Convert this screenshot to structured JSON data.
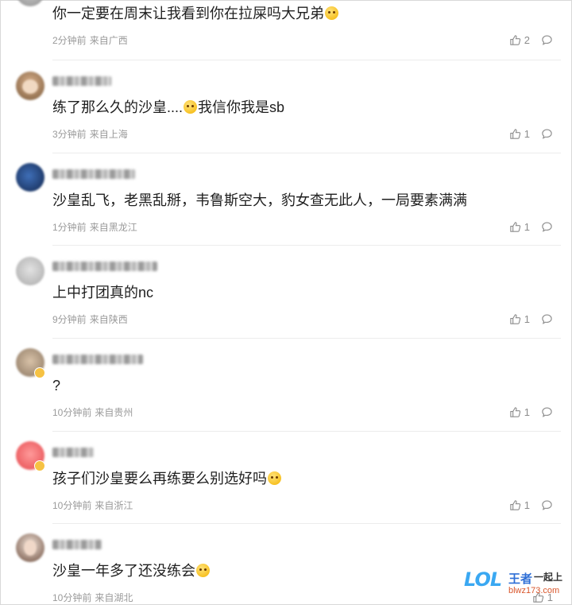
{
  "comments": [
    {
      "text": "你一定要在周末让我看到你在拉屎吗大兄弟",
      "emoji": "smile",
      "time": "2分钟前",
      "region": "来自广西",
      "likes": "2"
    },
    {
      "text_before": "练了那么久的沙皇....",
      "emoji": "wink",
      "text_after": "我信你我是sb",
      "time": "3分钟前",
      "region": "来自上海",
      "likes": "1"
    },
    {
      "text": "沙皇乱飞，老黑乱掰，韦鲁斯空大，豹女查无此人，一局要素满满",
      "time": "1分钟前",
      "region": "来自黑龙江",
      "likes": "1"
    },
    {
      "text": "上中打团真的nc",
      "time": "9分钟前",
      "region": "来自陕西",
      "likes": "1"
    },
    {
      "text": "?",
      "time": "10分钟前",
      "region": "来自贵州",
      "likes": "1"
    },
    {
      "text": "孩子们沙皇要么再练要么别选好吗",
      "emoji": "laugh",
      "time": "10分钟前",
      "region": "来自浙江",
      "likes": "1"
    },
    {
      "text": "沙皇一年多了还没练会",
      "emoji": "dizzy",
      "time": "10分钟前",
      "region": "来自湖北",
      "likes": "1"
    }
  ],
  "watermark": {
    "logo": "LOL",
    "brand": "王者",
    "tagline": "一起上",
    "url": "blwz173.com"
  },
  "icons": {
    "like": "thumbs-up-icon",
    "reply": "comment-bubble-icon"
  }
}
